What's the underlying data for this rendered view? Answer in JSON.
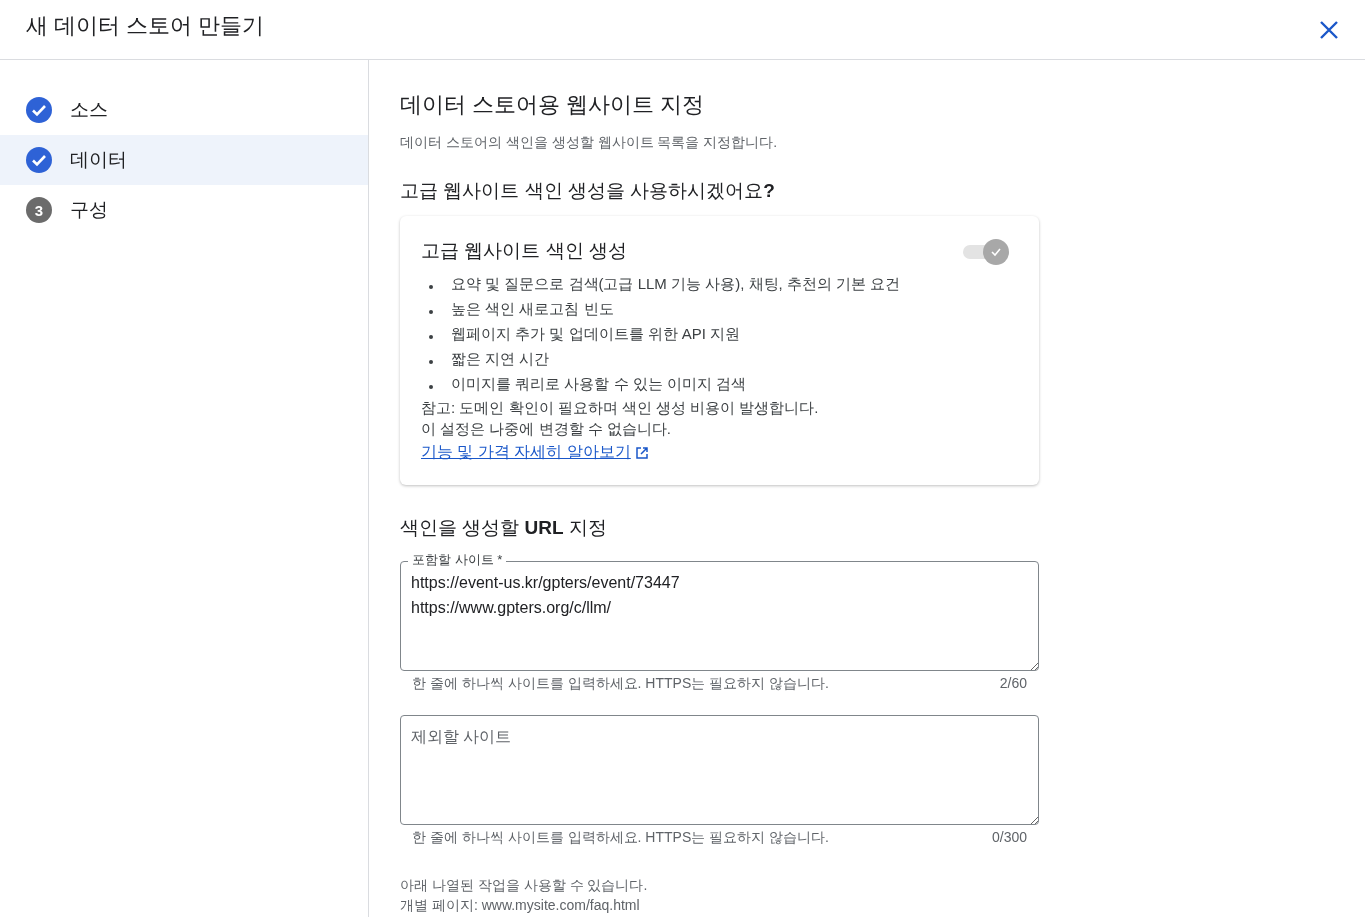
{
  "dialog": {
    "title": "새 데이터 스토어 만들기"
  },
  "steps": [
    {
      "label": "소스",
      "kind": "done",
      "selected": false
    },
    {
      "label": "데이터",
      "kind": "done",
      "selected": true
    },
    {
      "label": "구성",
      "kind": "number",
      "number": "3",
      "selected": false
    }
  ],
  "content": {
    "heading": "데이터 스토어용 웹사이트 지정",
    "description": "데이터 스토어의 색인을 생성할 웹사이트 목록을 지정합니다.",
    "question": "고급 웹사이트 색인 생성을 사용하시겠어요**?**",
    "card": {
      "title": "고급 웹사이트 색인 생성",
      "toggle": {
        "on": true,
        "disabled": true
      },
      "bullets": [
        "요약 및 질문으로 검색(고급 LLM 기능 사용), 채팅, 추천의 기본 요건",
        "높은 색인 새로고침 빈도",
        "웹페이지 추가 및 업데이트를 위한 API 지원",
        "짧은 지연 시간",
        "이미지를 쿼리로 사용할 수 있는 이미지 검색"
      ],
      "notes": [
        "참고: 도메인 확인이 필요하며 색인 생성 비용이 발생합니다.",
        "이 설정은 나중에 변경할 수 없습니다."
      ],
      "link": "기능 및 가격 자세히 알아보기"
    },
    "url_heading": "색인을 생성할 **URL** 지정",
    "fields": [
      {
        "label": "포함할 사이트 *",
        "lines": [
          "https://event-us.kr/gpters/event/73447",
          "https://www.gpters.org/c/llm/"
        ],
        "hint": "한 줄에 하나씩 사이트를 입력하세요. HTTPS는 필요하지 않습니다.",
        "count": "2/60"
      },
      {
        "placeholder": "제외할 사이트",
        "hint": "한 줄에 하나씩 사이트를 입력하세요. HTTPS는 필요하지 않습니다.",
        "count": "0/300"
      }
    ],
    "footer_lines": [
      "아래 나열된 작업을 사용할 수 있습니다.",
      "개별 페이지: www.mysite.com/faq.html"
    ]
  }
}
